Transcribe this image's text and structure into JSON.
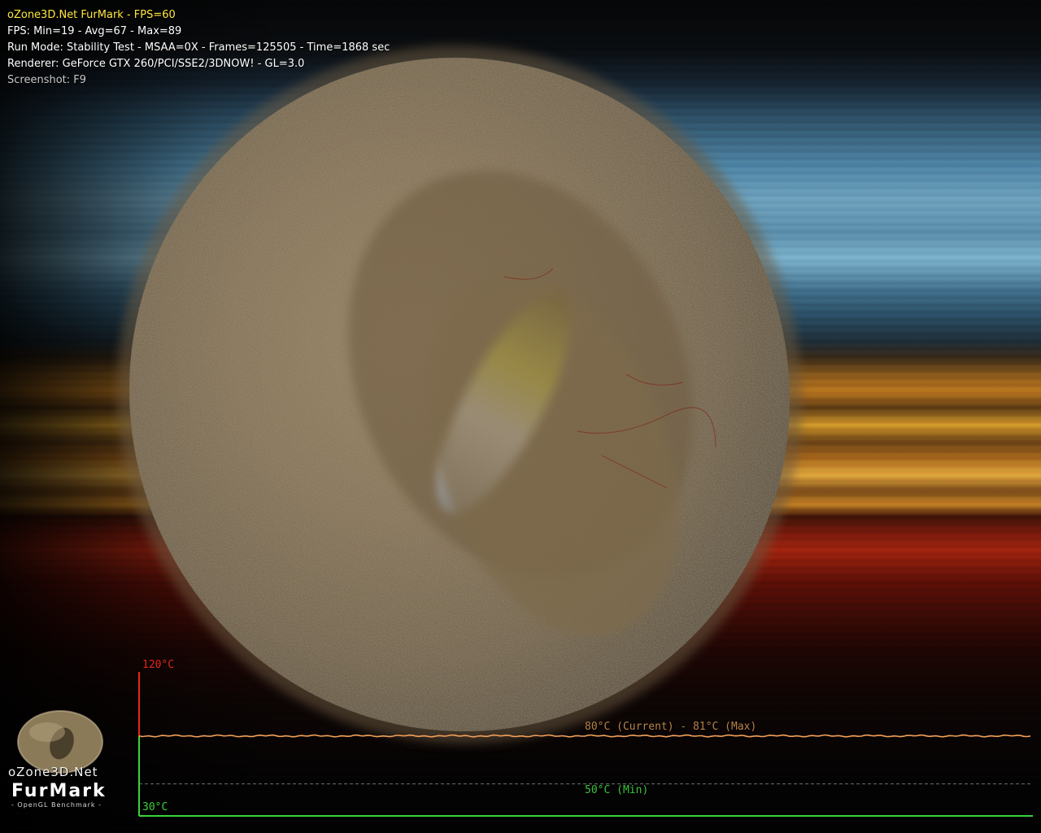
{
  "app": {
    "title_line": "oZone3D.Net FurMark - FPS=60",
    "fps_line": "FPS: Min=19 - Avg=67 - Max=89",
    "run_mode_line": "Run Mode: Stability Test - MSAA=0X - Frames=125505 - Time=1868 sec",
    "renderer_line": "Renderer: GeForce GTX 260/PCI/SSE2/3DNOW! - GL=3.0",
    "screenshot_hint": "Screenshot: F9"
  },
  "temperature_graph": {
    "max_label": "120°C",
    "min_axis_label": "30°C",
    "current_label": "80°C (Current) - 81°C (Max)",
    "min_label": "50°C (Min)",
    "axis_min_c": 30,
    "axis_max_c": 120,
    "current_c": 80,
    "max_c": 81,
    "min_c": 50,
    "colors": {
      "max_axis": "#e8261c",
      "min_axis": "#37d43a",
      "current_line": "#f2a15a",
      "current_text": "#b8844a",
      "min_text": "#3cc23c"
    }
  },
  "logo": {
    "site": "oZone3D.Net",
    "brand": "FurMark",
    "tagline": "- OpenGL Benchmark -"
  }
}
